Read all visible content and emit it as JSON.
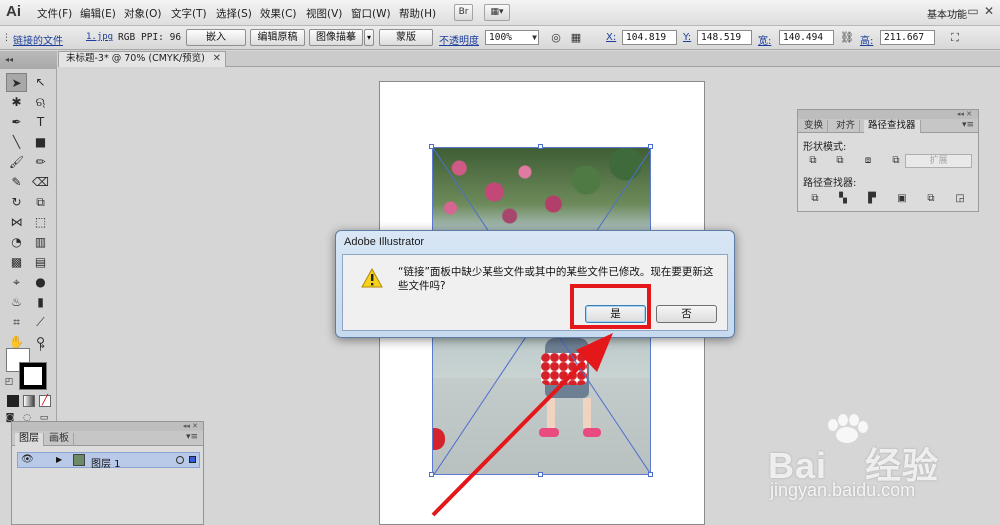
{
  "app": {
    "logo": "Ai",
    "workspace": "基本功能"
  },
  "menu": {
    "items": [
      "文件(F)",
      "编辑(E)",
      "对象(O)",
      "文字(T)",
      "选择(S)",
      "效果(C)",
      "视图(V)",
      "窗口(W)",
      "帮助(H)"
    ],
    "bridge_btn": "Br"
  },
  "control": {
    "linked_file": "链接的文件",
    "file_name": "1.jpg",
    "color_mode": "RGB",
    "ppi": "PPI: 96",
    "embed": "嵌入",
    "edit_original": "编辑原稿",
    "image_trace": "图像描摹",
    "mask": "蒙版",
    "opacity_label": "不透明度",
    "opacity_value": "100%",
    "x_label": "X:",
    "x_value": "104.819",
    "y_label": "Y:",
    "y_value": "148.519",
    "w_label": "宽:",
    "w_value": "140.494",
    "h_label": "高:",
    "h_value": "211.667"
  },
  "document": {
    "tab_title": "未标题-3* @ 70% (CMYK/预览)"
  },
  "pathfinder": {
    "tabs": [
      "变换",
      "对齐",
      "路径查找器"
    ],
    "shape_modes": "形状模式:",
    "pathfinders": "路径查找器:",
    "expand": "扩展"
  },
  "layers": {
    "tabs": [
      "图层",
      "画板"
    ],
    "layer_name": "图层 1"
  },
  "dialog": {
    "title": "Adobe Illustrator",
    "message": "“链接”面板中缺少某些文件或其中的某些文件已修改。现在要更新这些文件吗?",
    "yes": "是",
    "no": "否"
  },
  "watermark": {
    "brand": "Bai",
    "brand_cn": "经验",
    "url": "jingyan.baidu.com"
  },
  "colors": {
    "highlight": "#e4171b",
    "selection": "#4b6fcf",
    "dialog_frame": "#5d7da5"
  }
}
